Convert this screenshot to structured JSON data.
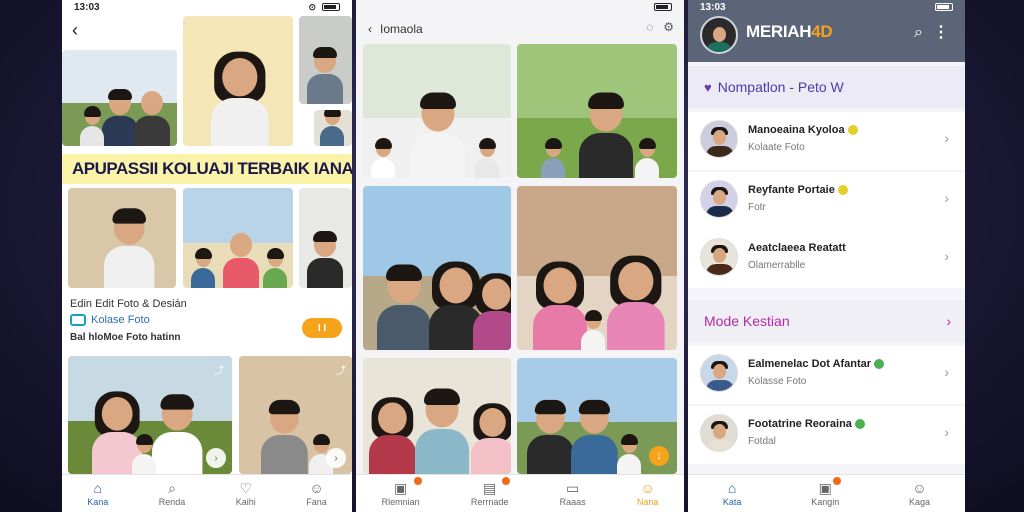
{
  "panel1": {
    "status_time": "13:03",
    "status_icon": "⊙",
    "banner_text": "APUPASSII KOLUAJI TERBAIK IANA",
    "edit_title": "Edin Edit Foto & Desián",
    "collage_label": "Kolase Foto",
    "sub_line": "Bal hloMoe Foto hatinn",
    "pill_label": "I I",
    "nav": [
      "Kana",
      "Renda",
      "Kaihi",
      "Fana"
    ]
  },
  "panel2": {
    "title": "Iomaola",
    "nav": [
      "Rlemnian",
      "Rerrnade",
      "Raaas",
      "Nana"
    ]
  },
  "panel3": {
    "status_time": "13:03",
    "brand_a": "MERIAH",
    "brand_b": "4D",
    "section1_title": "Nompatlon - Peto W",
    "section2_title": "Mode Kestian",
    "contacts_a": [
      {
        "name": "Manoeaina Kyoloa",
        "sub": "Kolaate Foto"
      },
      {
        "name": "Reyfante Portaie",
        "sub": "Fotr"
      },
      {
        "name": "Aeatclaeea Reatatt",
        "sub": "Olamerrablle"
      }
    ],
    "contacts_b": [
      {
        "name": "Ealmenelac Dot Afantar",
        "sub": "Kolasse Foto"
      },
      {
        "name": "Footatrine Reoraina",
        "sub": "Fotdal"
      }
    ],
    "nav": [
      "Kata",
      "Kangin",
      "Kaga"
    ]
  },
  "colors": {
    "accent_orange": "#f4a31a",
    "brand_purple": "#4a3fa8",
    "nav_blue": "#2b5fa8",
    "header_gray": "#5c6477"
  }
}
